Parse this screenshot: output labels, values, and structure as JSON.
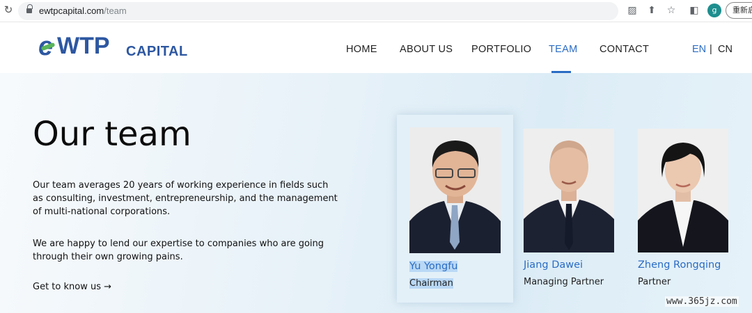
{
  "browser": {
    "url_domain": "ewtpcapital.com",
    "url_path": "/team",
    "profile_initial": "g",
    "relaunch_label": "重新启"
  },
  "logo": {
    "e": "e",
    "wtp": "WTP",
    "capital": "CAPITAL"
  },
  "nav": {
    "items": [
      "HOME",
      "ABOUT US",
      "PORTFOLIO",
      "TEAM",
      "CONTACT"
    ],
    "active": "TEAM",
    "lang_en": "EN",
    "lang_sep": "|",
    "lang_cn": "CN"
  },
  "hero": {
    "title": "Our team",
    "paragraph1": "Our team averages 20 years of working experience in fields such as consulting, investment, entrepreneurship, and the management of multi-national corporations.",
    "paragraph2": "We are happy to lend our expertise to companies who are going through their own growing pains.",
    "link": "Get to know us →"
  },
  "team": [
    {
      "name": "Yu Yongfu",
      "role": "Chairman",
      "highlighted": true
    },
    {
      "name": "Jiang Dawei",
      "role": "Managing Partner",
      "highlighted": false
    },
    {
      "name": "Zheng Rongqing",
      "role": "Partner",
      "highlighted": false
    }
  ],
  "watermark": "www.365jz.com",
  "colors": {
    "brand_blue": "#2d57a1",
    "link_blue": "#2a6cc4",
    "logo_green": "#5ab55a"
  }
}
